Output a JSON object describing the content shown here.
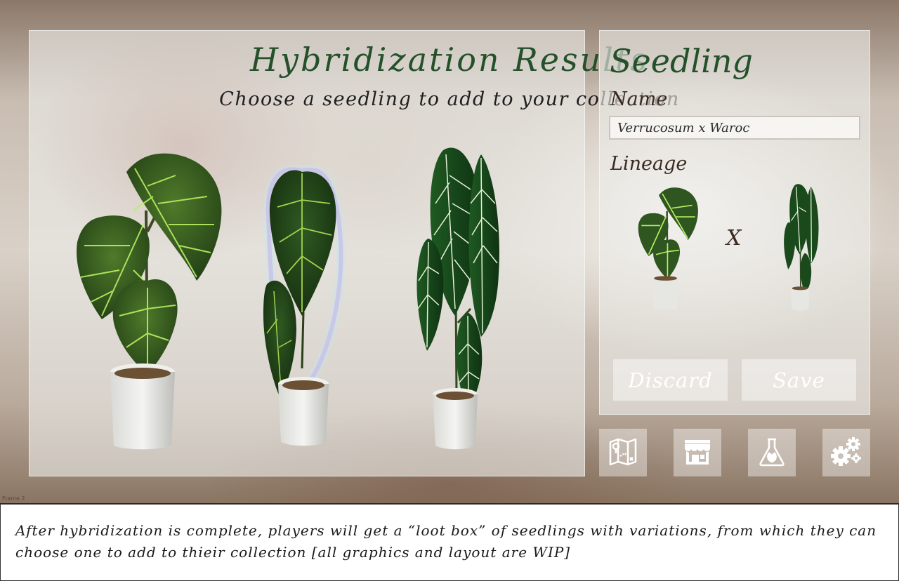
{
  "results_panel": {
    "title": "Hybridization Results",
    "subtitle": "Choose a seedling to add to your collection",
    "seedlings": [
      {
        "selected": false
      },
      {
        "selected": true
      },
      {
        "selected": false
      }
    ]
  },
  "seedling_panel": {
    "title": "Seedling",
    "name_label": "Name",
    "name_value": "Verrucosum x Waroc",
    "lineage_label": "Lineage",
    "cross_symbol": "X",
    "discard_label": "Discard",
    "save_label": "Save"
  },
  "nav": {
    "icons": [
      "map-icon",
      "shop-icon",
      "lab-flask-icon",
      "settings-gears-icon"
    ]
  },
  "frame_label": "Frame 2",
  "caption": "After hybridization is complete, players will get a “loot box” of seedlings with variations, from which they can choose one to add to thieir collection [all graphics and layout are WIP]",
  "colors": {
    "title_green": "#24502a",
    "panel_fill": "rgba(236,236,232,0.62)",
    "selection_glow": "#c9a8e8"
  }
}
